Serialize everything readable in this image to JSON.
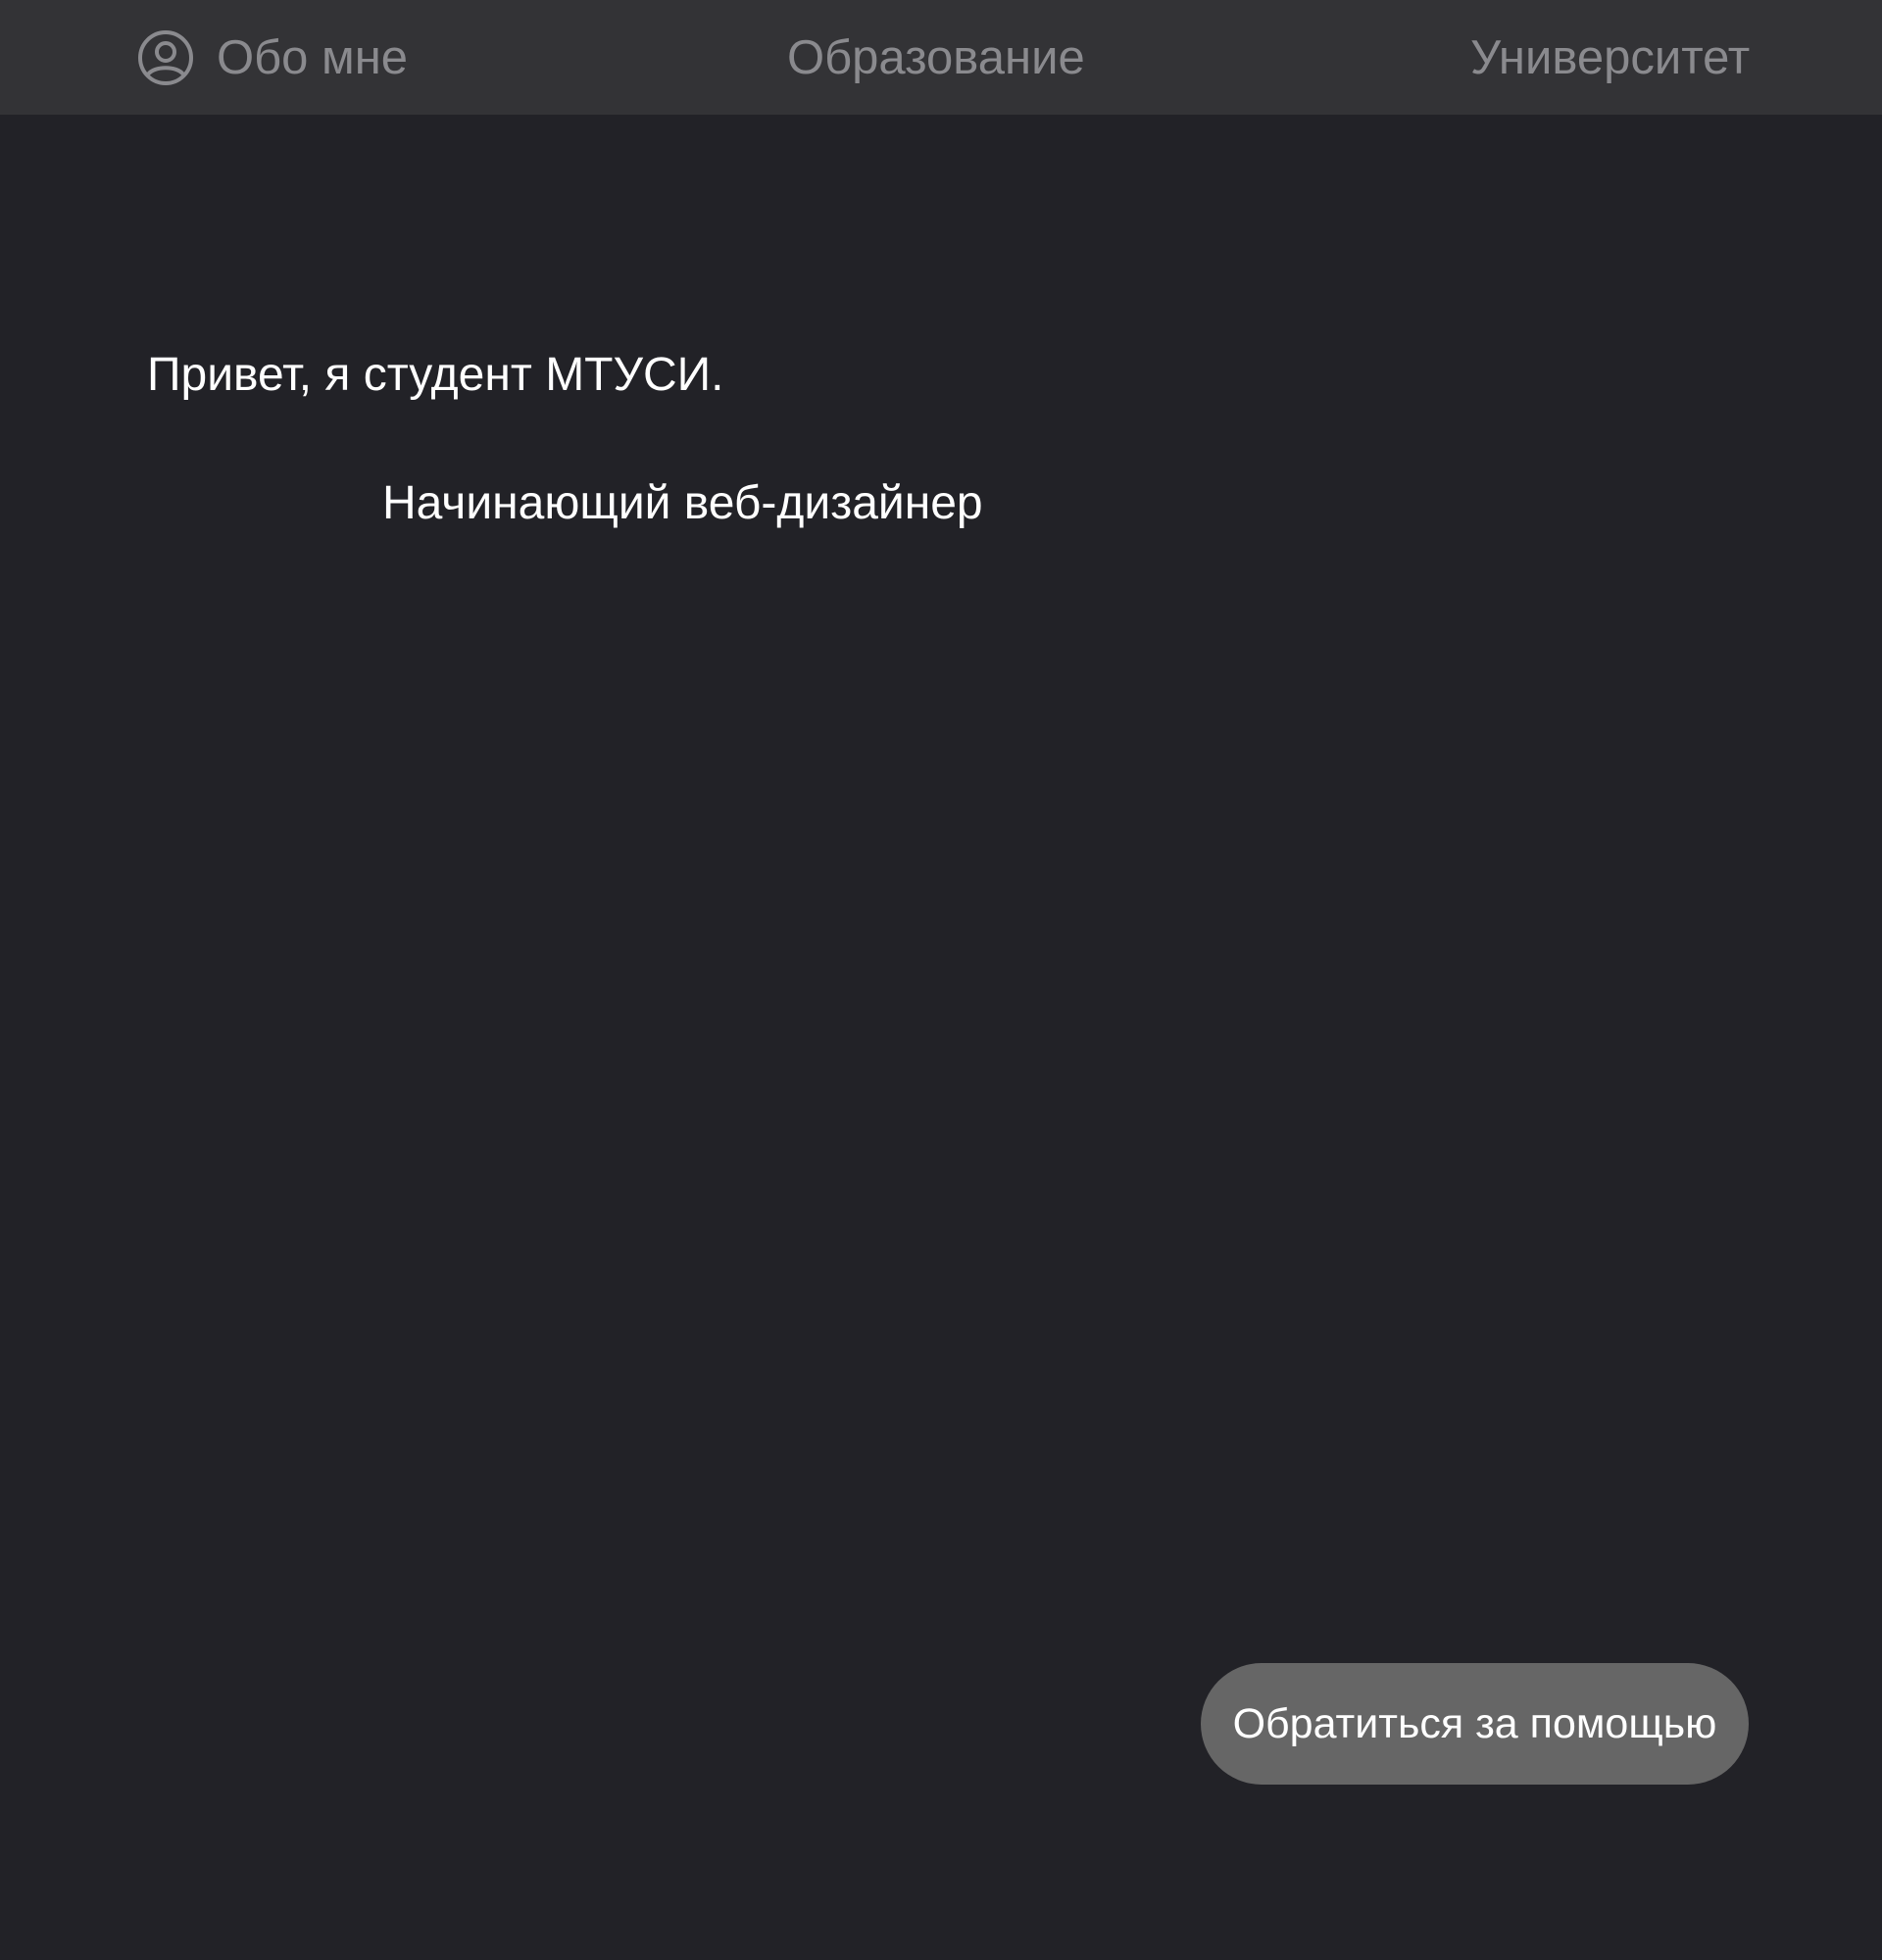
{
  "nav": {
    "about": {
      "label": "Обо мне",
      "icon": "user-circle-icon"
    },
    "education": {
      "label": "Образование"
    },
    "university": {
      "label": "Университет"
    }
  },
  "main": {
    "greeting": "Привет, я студент МТУСИ.",
    "subtitle": "Начинающий веб-дизайнер"
  },
  "help_button": {
    "label": "Обратиться за помощью"
  },
  "colors": {
    "background": "#222227",
    "topbar": "#333336",
    "nav_text": "#8a8a8e",
    "button": "#666666",
    "text": "#ffffff"
  }
}
